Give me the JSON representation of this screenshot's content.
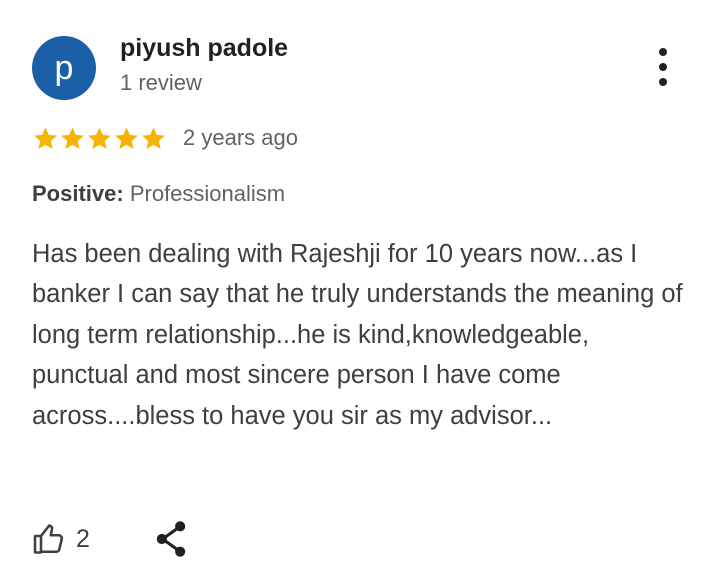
{
  "reviewer": {
    "initial": "p",
    "name": "piyush padole",
    "review_count": "1 review",
    "avatar_color": "#1a5fa8"
  },
  "menu": {
    "icon": "more-vert-icon"
  },
  "rating": {
    "stars": 5,
    "max_stars": 5,
    "star_color": "#f6b400",
    "date": "2 years ago"
  },
  "attribute": {
    "label": "Positive:",
    "value": "Professionalism"
  },
  "review_text": "Has been dealing with Rajeshji for 10 years now...as I banker I can say that he truly understands the meaning of long term relationship...he is kind,knowledgeable, punctual and most sincere person I have come across....bless to have you sir as my advisor...",
  "actions": {
    "like_icon": "thumb-up-icon",
    "like_count": "2",
    "share_icon": "share-icon"
  }
}
